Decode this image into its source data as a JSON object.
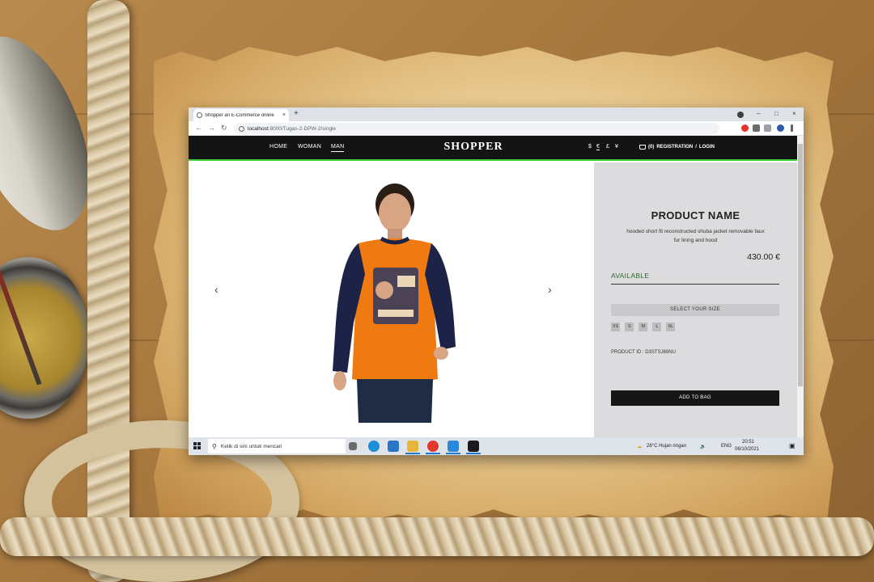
{
  "browser": {
    "tab_title": "Shopper an E-Commerce online",
    "tab_close": "×",
    "new_tab": "+",
    "url_host": "localhost",
    "url_path": ":8000/Tugas-2-DPW-2/single",
    "nav_back": "←",
    "nav_forward": "→",
    "nav_reload": "↻",
    "window_minimize": "–",
    "window_maximize": "□",
    "window_close": "×"
  },
  "header": {
    "nav": [
      "HOME",
      "WOMAN",
      "MAN"
    ],
    "active_nav": "MAN",
    "brand": "SHOPPER",
    "currencies": [
      "$",
      "€",
      "£",
      "¥"
    ],
    "active_currency": "€",
    "basket_count": "(0)",
    "registration": "REGISTRATION",
    "separator": "/",
    "login": "LOGIN"
  },
  "carousel": {
    "prev": "‹",
    "next": "›"
  },
  "product": {
    "name": "PRODUCT NAME",
    "description": "hooded short fit reconstructed shuba jacket removable faux fur lining and hood",
    "price": "430.00 €",
    "availability": "AVAILABLE",
    "size_label": "SELECT YOUR SIZE",
    "sizes": [
      "XS",
      "S",
      "M",
      "L",
      "XL"
    ],
    "product_id": "PRODUCT ID : D3STSJ69NU",
    "add_to_bag": "ADD TO BAG"
  },
  "taskbar": {
    "search_placeholder": "Ketik di sini untuk mencari",
    "weather": "28°C  Hujan ringan",
    "language": "ENG",
    "time": "20:51",
    "date": "06/10/2021"
  },
  "colors": {
    "header_bg": "#141414",
    "header_accent": "#3ecf3e",
    "details_bg": "#dcdcde",
    "available_green": "#2d6a2d",
    "tshirt_orange": "#f07a12",
    "tshirt_sleeves": "#1c2346"
  }
}
